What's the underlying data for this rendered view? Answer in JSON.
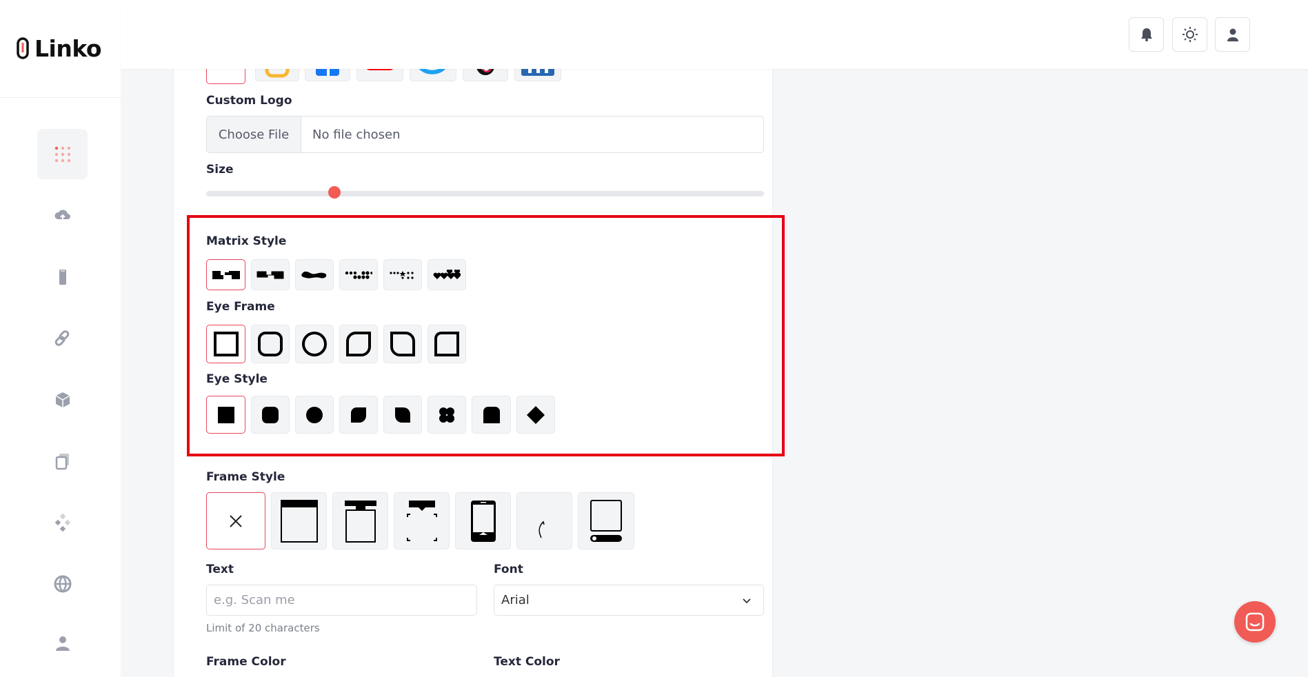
{
  "app": {
    "logo_text": "Linko",
    "accent": "#f25c54"
  },
  "sidebar": {
    "items": [
      {
        "icon": "grid-dots-icon",
        "active": true
      },
      {
        "icon": "cloud-upload-icon",
        "active": false
      },
      {
        "icon": "phone-icon",
        "active": false
      },
      {
        "icon": "link-icon",
        "active": false
      },
      {
        "icon": "cube-icon",
        "active": false
      },
      {
        "icon": "copy-icon",
        "active": false
      },
      {
        "icon": "diamond-dots-icon",
        "active": false
      },
      {
        "icon": "globe-icon",
        "active": false
      },
      {
        "icon": "user-icon",
        "active": false
      }
    ]
  },
  "header": {
    "buttons": [
      "bell-icon",
      "sun-icon",
      "user-icon"
    ]
  },
  "form": {
    "custom_logo_label": "Custom Logo",
    "file_button": "Choose File",
    "file_status": "No file chosen",
    "size_label": "Size",
    "size_value": 0.23,
    "matrix_style_label": "Matrix Style",
    "eye_frame_label": "Eye Frame",
    "eye_style_label": "Eye Style",
    "frame_style_label": "Frame Style",
    "text_label": "Text",
    "text_placeholder": "e.g. Scan me",
    "text_hint": "Limit of 20 characters",
    "font_label": "Font",
    "font_value": "Arial",
    "frame_color_label": "Frame Color",
    "text_color_label": "Text Color"
  }
}
